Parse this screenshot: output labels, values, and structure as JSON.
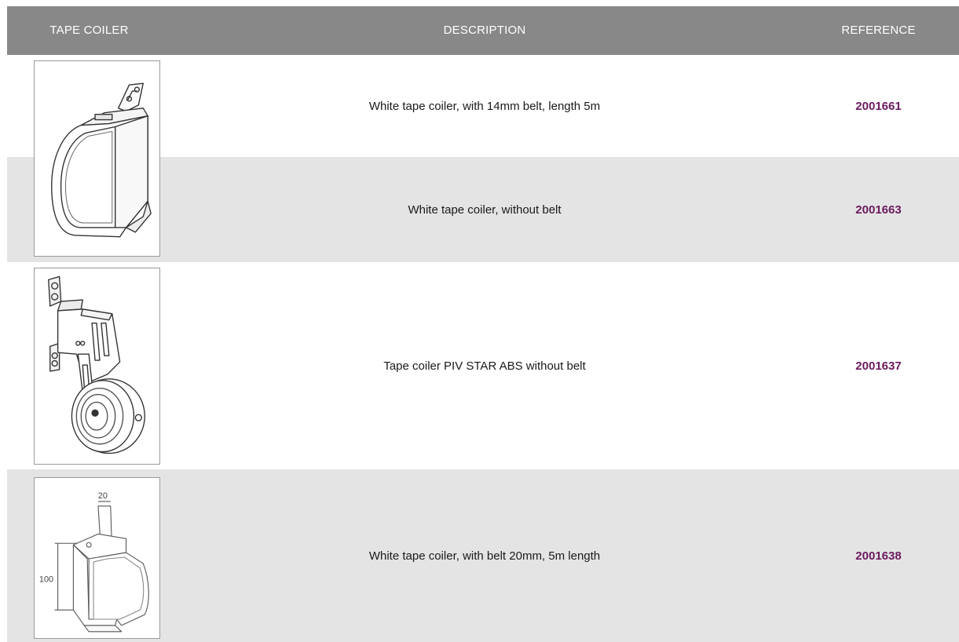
{
  "header": {
    "col_image": "TAPE COILER",
    "col_description": "DESCRIPTION",
    "col_reference": "REFERENCE"
  },
  "colors": {
    "header_bg": "#888888",
    "row_alt_bg": "#e4e4e4",
    "reference_color": "#6b1a5e"
  },
  "rows": [
    {
      "description": "White tape coiler, with 14mm belt, length 5m",
      "reference": "2001661",
      "image": "white-tape-coiler-image"
    },
    {
      "description": "White tape coiler, without belt",
      "reference": "2001663",
      "image": "white-tape-coiler-image"
    },
    {
      "description": "Tape coiler PIV STAR ABS without belt",
      "reference": "2001637",
      "image": "piv-star-coiler-image"
    },
    {
      "description": "White tape coiler, with belt 20mm, 5m length",
      "reference": "2001638",
      "image": "dimensioned-coiler-drawing"
    }
  ],
  "drawing_labels": {
    "width_label": "20",
    "height_label": "100"
  }
}
